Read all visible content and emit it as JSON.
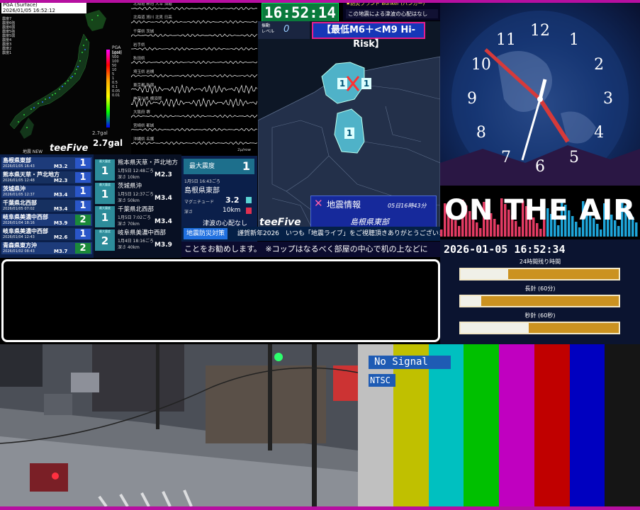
{
  "pga": {
    "title": "PGA (Surface)",
    "timestamp": "2026/01/05 16:52:12",
    "unit": "PGA [gal]",
    "scale_ticks": [
      "1000",
      "500",
      "100",
      "50",
      "10",
      "5",
      "1",
      "0.5",
      "0.1",
      "0.05",
      "0.01"
    ],
    "max_label": "2.7gal",
    "big_value": "2.7gal",
    "list": [
      "震度7",
      "震度6強",
      "震度6弱",
      "震度5強",
      "震度5弱",
      "震度4",
      "震度3",
      "震度2",
      "震度1"
    ]
  },
  "waves": {
    "labels": [
      "北海道 新冠 大幸 須磨",
      "北海道 旭川 北見 日高",
      "千葉県 茨城",
      "岩手県",
      "秋田県",
      "埼玉県 岩槻",
      "東京都 新宿",
      "神奈川県 横須賀",
      "大阪府 堺",
      "宮崎県 都城",
      "沖縄県 名護"
    ],
    "footer": "2μ/row"
  },
  "header": {
    "clock": "16:52:14",
    "bunker_title": "★防災ブランド Bunker (バンカー)",
    "bunker_msg": "この地震による津波の心配はなし"
  },
  "eq_map": {
    "level_label_1": "振動",
    "level_label_2": "レベル",
    "level_value": "0",
    "risk": "【最低M6＋<M9 Hi-Risk】",
    "logo": "teeFive",
    "info_title": "地震情報",
    "info_date": "05日16時43分",
    "info_region": "島根県東部",
    "map_intensities": [
      "1",
      "1",
      "1"
    ]
  },
  "intensity_list": {
    "rows": [
      {
        "name": "島根県東部",
        "date": "2026/01/05 16:43",
        "mag": "M3.2",
        "shindo": "1",
        "color": "#2a56c8"
      },
      {
        "name": "熊本県天草・芦北地方",
        "date": "2026/01/05 12:48",
        "mag": "M2.3",
        "shindo": "1",
        "color": "#2a56c8"
      },
      {
        "name": "茨城県沖",
        "date": "2026/01/05 12:37",
        "mag": "M3.4",
        "shindo": "1",
        "color": "#2a56c8"
      },
      {
        "name": "千葉県北西部",
        "date": "2026/01/05 07:02",
        "mag": "M3.4",
        "shindo": "1",
        "color": "#2a56c8"
      },
      {
        "name": "岐阜県美濃中西部",
        "date": "2026/01/04 18:16",
        "mag": "M3.9",
        "shindo": "2",
        "color": "#1b8a3a"
      },
      {
        "name": "岐阜県美濃中西部",
        "date": "2026/01/04 12:43",
        "mag": "M2.6",
        "shindo": "1",
        "color": "#2a56c8"
      },
      {
        "name": "青森県東方沖",
        "date": "2026/01/02 08:43",
        "mag": "M3.7",
        "shindo": "2",
        "color": "#1b8a3a"
      }
    ],
    "header": "地震 NEW",
    "logo": "teeFive"
  },
  "cards": [
    {
      "badge_label": "最大震度",
      "shindo": "1",
      "title": "熊本県天草・芦北地方",
      "date": "1月5日 12:48ごろ",
      "depth": "深さ 10km",
      "mag": "M2.3"
    },
    {
      "badge_label": "最大震度",
      "shindo": "1",
      "title": "茨城県沖",
      "date": "1月5日 12:37ごろ",
      "depth": "深さ 50km",
      "mag": "M3.4"
    },
    {
      "badge_label": "最大震度",
      "shindo": "1",
      "title": "千葉県北西部",
      "date": "1月5日 7:02ごろ",
      "depth": "深さ 70km",
      "mag": "M3.4"
    },
    {
      "badge_label": "最大震度",
      "shindo": "2",
      "title": "岐阜県美濃中西部",
      "date": "1月4日 18:16ごろ",
      "depth": "深さ 40km",
      "mag": "M3.9"
    }
  ],
  "detail": {
    "head_label": "最大震度",
    "head_value": "1",
    "date": "1月5日 16:43ごろ",
    "region": "島根県東部",
    "mag_label": "マグニチュード",
    "mag_value": "3.2",
    "depth_label": "深さ",
    "depth_value": "10km",
    "tsunami": "津波の心配なし"
  },
  "ticker": {
    "tag": "地震防災対策",
    "text": "謹賀新年2026　いつも「地震ライブ」をご視聴頂きありがとうございます!",
    "bottom": "ことをお勧めします。　※コップはなるべく部屋の中心で机の上などに"
  },
  "analog_clock": {
    "numbers": [
      "12",
      "1",
      "2",
      "3",
      "4",
      "5",
      "6",
      "7",
      "8",
      "9",
      "10",
      "11"
    ]
  },
  "onair": "ON THE AIR",
  "digital": {
    "datetime": "2026-01-05 16:52:34",
    "label_24h": "24時間残り時間",
    "label_min": "長針 (60分)",
    "label_sec": "秒針 (60秒)",
    "progress_24h": 0.3,
    "progress_min": 0.13,
    "progress_sec": 0.43
  },
  "color_bars": {
    "no_signal": "No Signal",
    "ntsc": "NTSC",
    "colors": [
      "#c0c0c0",
      "#c0c000",
      "#00c0c0",
      "#00c000",
      "#c000c0",
      "#c00000",
      "#0000c0",
      "#151515"
    ]
  },
  "colors": {
    "frame": "#b60fa0",
    "accent": "#1637b8",
    "risk_border": "#e61e8c"
  }
}
